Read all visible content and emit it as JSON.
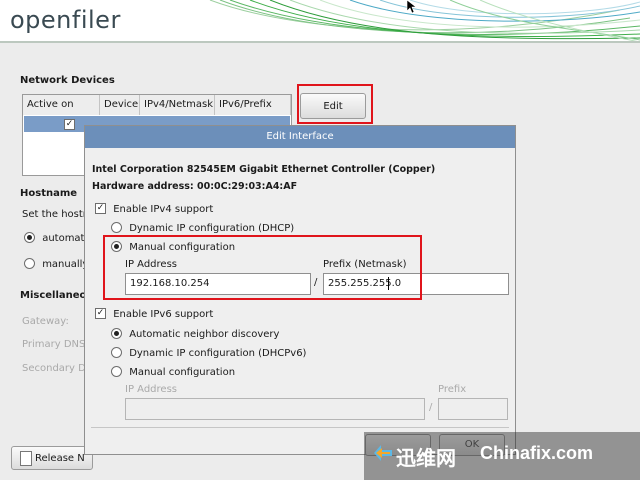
{
  "header": {
    "logo_text": "openfiler"
  },
  "network_devices": {
    "label": "Network Devices",
    "columns": [
      "Active on Boot",
      "Device",
      "IPv4/Netmask",
      "IPv6/Prefix"
    ],
    "rows": [
      {
        "active": true,
        "device": "",
        "ipv4": "",
        "ipv6": ""
      }
    ],
    "edit_button": "Edit"
  },
  "hostname": {
    "label": "Hostname",
    "set_text": "Set the hostn",
    "option_auto": "automatic",
    "option_manual": "manually"
  },
  "misc": {
    "label": "Miscellaneou",
    "gateway": "Gateway:",
    "primary_dns": "Primary DNS",
    "secondary_dns": "Secondary D"
  },
  "release_button": "Release N",
  "dialog": {
    "title": "Edit Interface",
    "device_name": "Intel Corporation 82545EM Gigabit Ethernet Controller (Copper)",
    "hardware": "Hardware address: 00:0C:29:03:A4:AF",
    "ipv4": {
      "enable": "Enable IPv4 support",
      "dhcp": "Dynamic IP configuration (DHCP)",
      "manual": "Manual configuration",
      "ip_label": "IP Address",
      "prefix_label": "Prefix (Netmask)",
      "ip_value": "192.168.10.254",
      "separator": "/",
      "prefix_value": "255.255.255.0"
    },
    "ipv6": {
      "enable": "Enable IPv6 support",
      "auto": "Automatic neighbor discovery",
      "dhcp": "Dynamic IP configuration (DHCPv6)",
      "manual": "Manual configuration",
      "ip_label": "IP Address",
      "prefix_label": "Prefix",
      "separator": "/"
    },
    "ok_button": "OK"
  },
  "watermark": {
    "cn_text": "迅维网",
    "brand": "Chinafix.com"
  },
  "colors": {
    "title_bar": "#6c8fba",
    "highlight_red": "#e0141b",
    "selection": "#7a9cc7",
    "header_swirl": "#3fae4a"
  }
}
